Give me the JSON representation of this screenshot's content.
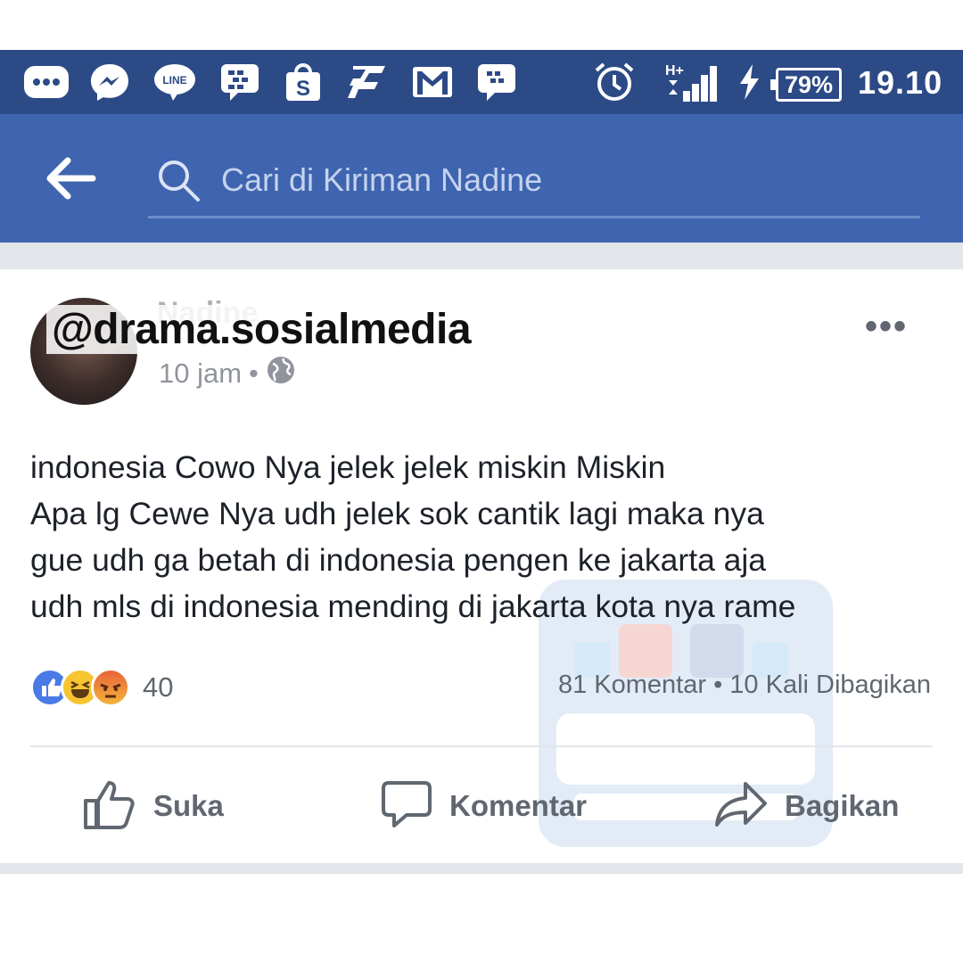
{
  "status_bar": {
    "icons": [
      "more-icon",
      "messenger-icon",
      "line-icon",
      "bbm-icon",
      "shop-icon",
      "app-icon",
      "gmail-icon",
      "bbm-chat-icon",
      "alarm-icon",
      "signal-icon",
      "charging-icon"
    ],
    "network": "H+",
    "battery": "79%",
    "time": "19.10"
  },
  "app_bar": {
    "search_placeholder": "Cari di Kiriman Nadine",
    "colors": {
      "status": "#2c4a86",
      "bar": "#3f65b0"
    }
  },
  "post": {
    "author": "Nadine",
    "overlay_text": "@drama.sosialmedia",
    "time": "10 jam",
    "privacy_icon": "globe-icon",
    "text": "indonesia Cowo Nya jelek jelek miskin Miskin\nApa lg Cewe Nya udh jelek sok cantik lagi maka nya\ngue udh ga betah di indonesia pengen ke jakarta aja\nudh mls di indonesia mending di jakarta kota nya rame",
    "reactions": [
      "like",
      "haha",
      "angry"
    ],
    "reaction_count": "40",
    "stats": "81 Komentar • 10 Kali Dibagikan"
  },
  "actions": {
    "like": "Suka",
    "comment": "Komentar",
    "share": "Bagikan"
  }
}
